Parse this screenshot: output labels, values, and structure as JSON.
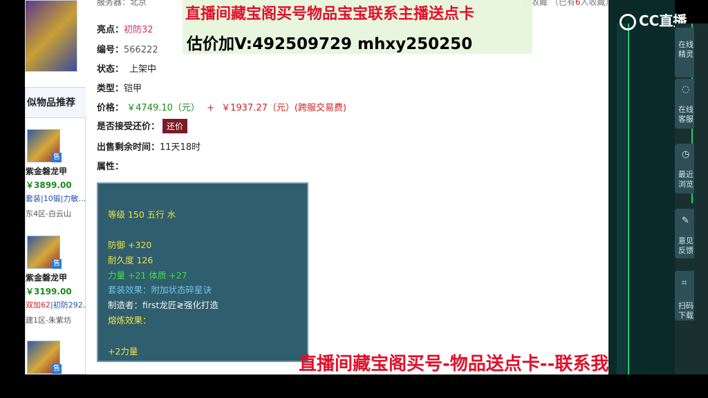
{
  "top_row": {
    "label": "服务器：",
    "value": "北京"
  },
  "banner": {
    "line1": "直播间藏宝阁买号物品宝宝联系主播送点卡",
    "line2": "估价加V:492509729    mhxy250250"
  },
  "collect": {
    "prefix": "已收藏",
    "count_prefix": "（已有",
    "count": "6",
    "count_suffix": "人收藏）"
  },
  "item": {
    "highlight_label": "亮点：",
    "highlight_value": "初防32",
    "id_label": "编号：",
    "id_value": "566222",
    "status_label": "状态：",
    "status_value": "上架中",
    "type_label": "类型：",
    "type_value": "铠甲",
    "price_label": "价格：",
    "price_main": "￥4749.10（元）",
    "price_plus": "+",
    "price_fee": "￥1937.27（元）(跨服交易费)",
    "counter_label": "是否接受还价：",
    "counter_button": "还价",
    "time_label": "出售剩余时间：",
    "time_value": "11天18时",
    "attr_label": "属性："
  },
  "attributes": {
    "level": "等级 150 五行 水",
    "defense": "防御 +320",
    "durability": "耐久度 126",
    "stats": "力量 +21 体质 +27",
    "set_effect": "套装效果：附加状态碎星诀",
    "maker": "制造者：first龙匠≷强化打造",
    "refine_label": "熔炼效果：",
    "refine_value": "+2力量"
  },
  "recommend": {
    "title": "似物品推荐",
    "badge": "售",
    "items": [
      {
        "name": "紫金磐龙甲",
        "price": "￥3899.00",
        "tags": "套装|10锻|力敏…",
        "server": "东4区-白云山"
      },
      {
        "name": "紫金磐龙甲",
        "price": "￥3199.00",
        "tags_red": "双加62",
        "tags": "|初防292…",
        "server": "建1区-朱紫坊"
      }
    ]
  },
  "cc_logo": "CC直播",
  "sidebar": [
    {
      "line1": "在线",
      "line2": "精灵"
    },
    {
      "line1": "在线",
      "line2": "客服"
    },
    {
      "line1": "最近",
      "line2": "浏览"
    },
    {
      "line1": "意见",
      "line2": "反馈"
    },
    {
      "line1": "扫码",
      "line2": "下载"
    }
  ],
  "bottom_banner": "直播间藏宝阁买号-物品送点卡--联系我"
}
